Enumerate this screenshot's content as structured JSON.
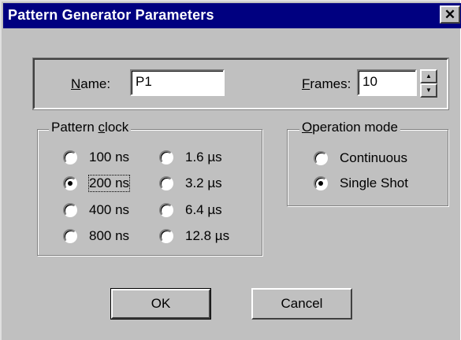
{
  "window": {
    "title": "Pattern Generator Parameters",
    "close_glyph": "✕"
  },
  "name_field": {
    "label_accel": "N",
    "label_rest": "ame:",
    "value": "P1"
  },
  "frames_field": {
    "label_accel": "F",
    "label_rest": "rames:",
    "value": "10",
    "up_glyph": "▲",
    "down_glyph": "▼"
  },
  "pattern_clock": {
    "label_pre": "Pattern ",
    "label_accel": "c",
    "label_post": "lock",
    "options": [
      "100 ns",
      "200 ns",
      "400 ns",
      "800 ns",
      "1.6 µs",
      "3.2 µs",
      "6.4 µs",
      "12.8 µs"
    ],
    "selected": "200 ns"
  },
  "operation_mode": {
    "label_accel": "O",
    "label_rest": "peration mode",
    "options": [
      "Continuous",
      "Single Shot"
    ],
    "selected": "Single Shot"
  },
  "buttons": {
    "ok": "OK",
    "cancel": "Cancel"
  },
  "colors": {
    "title_bar": "#000080",
    "dialog_face": "#c0c0c0"
  }
}
